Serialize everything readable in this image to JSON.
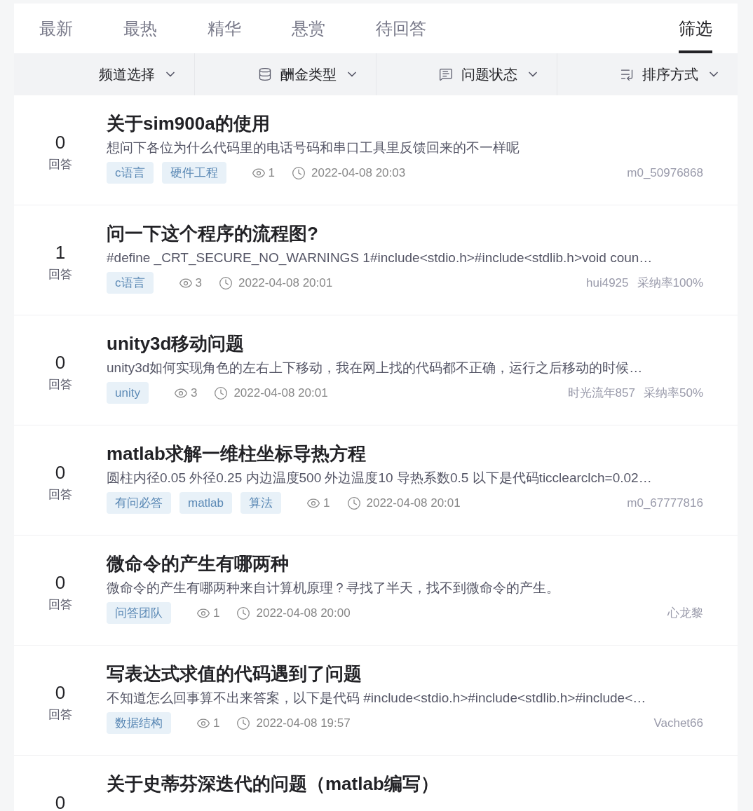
{
  "tabs": [
    {
      "label": "最新",
      "selected": false,
      "kind": "sort"
    },
    {
      "label": "最热",
      "selected": false,
      "kind": "sort"
    },
    {
      "label": "精华",
      "selected": false,
      "kind": "sort"
    },
    {
      "label": "悬赏",
      "selected": false,
      "kind": "sort"
    },
    {
      "label": "待回答",
      "selected": false,
      "kind": "sort"
    },
    {
      "label": "筛选",
      "selected": true,
      "kind": "filter"
    }
  ],
  "filters": [
    {
      "label": "频道选择",
      "kind": "plain"
    },
    {
      "label": "酬金类型",
      "kind": "reward"
    },
    {
      "label": "问题状态",
      "kind": "status"
    },
    {
      "label": "排序方式",
      "kind": "order"
    }
  ],
  "questions": [
    {
      "count": "0",
      "count_label": "回答",
      "title": "关于sim900a的使用",
      "description": "想问下各位为什么代码里的电话号码和串口工具里反馈回来的不一样呢",
      "tags": [
        "c语言",
        "硬件工程"
      ],
      "views": "1",
      "time": "2022-04-08 20:03",
      "author": "m0_50976868"
    },
    {
      "count": "1",
      "count_label": "回答",
      "title": "问一下这个程序的流程图?",
      "description": "#define _CRT_SECURE_NO_WARNINGS 1#include<stdio.h>#include<stdlib.h>void coun…",
      "tags": [
        "c语言"
      ],
      "views": "3",
      "time": "2022-04-08 20:01",
      "author": "hui4925",
      "accept_rate": "采纳率100%"
    },
    {
      "count": "0",
      "count_label": "回答",
      "title": "unity3d移动问题",
      "description": "unity3d如何实现角色的左右上下移动，我在网上找的代码都不正确，运行之后移动的时候…",
      "tags": [
        "unity"
      ],
      "views": "3",
      "time": "2022-04-08 20:01",
      "author": "时光流年857",
      "accept_rate": "采纳率50%"
    },
    {
      "count": "0",
      "count_label": "回答",
      "title": "matlab求解一维柱坐标导热方程",
      "description": "圆柱内径0.05 外径0.25 内边温度500 外边温度10 导热系数0.5 以下是代码ticclearclch=0.02…",
      "tags": [
        "有问必答",
        "matlab",
        "算法"
      ],
      "views": "1",
      "time": "2022-04-08 20:01",
      "author": "m0_67777816"
    },
    {
      "count": "0",
      "count_label": "回答",
      "title": "微命令的产生有哪两种",
      "description": "微命令的产生有哪两种来自计算机原理？寻找了半天，找不到微命令的产生。",
      "tags": [
        "问答团队"
      ],
      "views": "1",
      "time": "2022-04-08 20:00",
      "author": "心龙黎"
    },
    {
      "count": "0",
      "count_label": "回答",
      "title": "写表达式求值的代码遇到了问题",
      "description": "不知道怎么回事算不出来答案，以下是代码 #include<stdio.h>#include<stdlib.h>#include<…",
      "tags": [
        "数据结构"
      ],
      "views": "1",
      "time": "2022-04-08 19:57",
      "author": "Vachet66"
    },
    {
      "count": "0",
      "title": "关于史蒂芬深迭代的问题（matlab编写）"
    }
  ]
}
